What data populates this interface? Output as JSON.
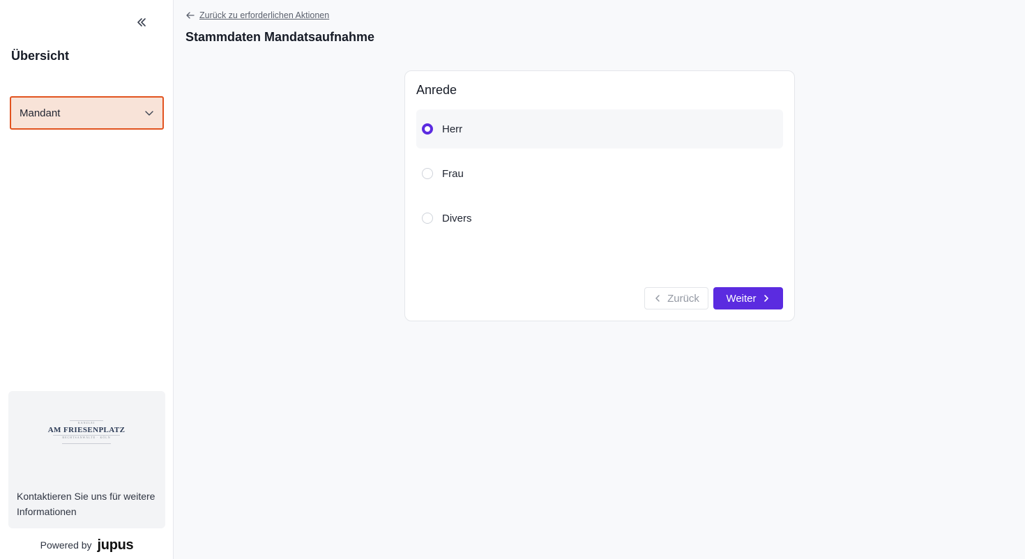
{
  "sidebar": {
    "collapse_icon": "chevrons-left-icon",
    "title": "Übersicht",
    "nav_items": [
      {
        "label": "Mandant",
        "icon": "chevron-down-icon",
        "active": true
      }
    ],
    "contact": {
      "logo": {
        "top_text": "KANZLEI",
        "main_text": "AM FRIESENPLATZ",
        "bottom_text": "RECHTSANWÄLTE · KÖLN"
      },
      "text": "Kontaktieren Sie uns für weitere Informationen"
    },
    "powered_by": {
      "label": "Powered by",
      "brand": "jupus"
    }
  },
  "header": {
    "back_link": "Zurück zu erforderlichen Aktionen",
    "back_icon": "arrow-left-icon",
    "title": "Stammdaten Mandatsaufnahme"
  },
  "form": {
    "question": "Anrede",
    "options": [
      {
        "label": "Herr",
        "selected": true
      },
      {
        "label": "Frau",
        "selected": false
      },
      {
        "label": "Divers",
        "selected": false
      }
    ],
    "back_button": "Zurück",
    "next_button": "Weiter"
  },
  "colors": {
    "accent": "#5b2be0",
    "active_nav_border": "#e2531f",
    "active_nav_bg": "#f8e3d8",
    "page_bg": "#f8f9fb"
  }
}
